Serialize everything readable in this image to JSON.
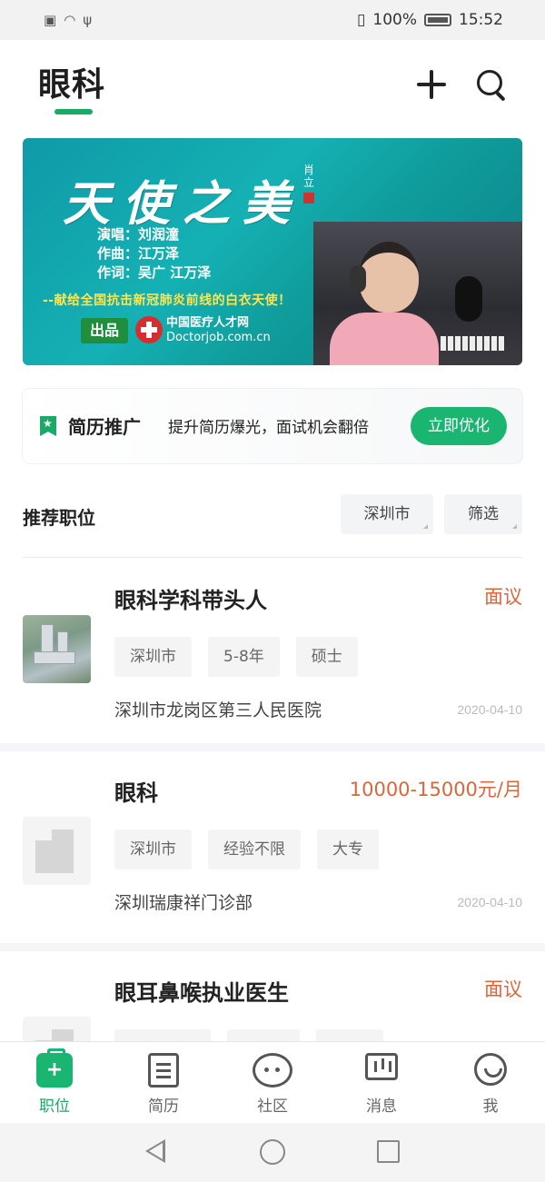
{
  "status_bar": {
    "left_icons": [
      "alert-icon",
      "wifi-icon",
      "usb-icon"
    ],
    "battery_percent": "100%",
    "time": "15:52"
  },
  "header": {
    "title": "眼科",
    "accent_color": "#1aaa68"
  },
  "banner": {
    "title": "天使之美",
    "seal_text": "肖立",
    "credits": [
      "演唱：刘润潼",
      "作曲：江万泽",
      "作词：吴广  江万泽"
    ],
    "slogan": "--献给全国抗击新冠肺炎前线的白衣天使！",
    "produced_label": "出品",
    "org_name": "中国医疗人才网",
    "org_site": "Doctorjob.com.cn"
  },
  "promo": {
    "title": "简历推广",
    "text": "提升简历爆光，面试机会翻倍",
    "button": "立即优化"
  },
  "section": {
    "title": "推荐职位",
    "city_filter": "深圳市",
    "more_filter": "筛选"
  },
  "jobs": [
    {
      "name": "眼科学科带头人",
      "salary": "面议",
      "tags": [
        "深圳市",
        "5-8年",
        "硕士"
      ],
      "hospital": "深圳市龙岗区第三人民医院",
      "date": "2020-04-10"
    },
    {
      "name": "眼科",
      "salary": "10000-15000元/月",
      "tags": [
        "深圳市",
        "经验不限",
        "大专"
      ],
      "hospital": "深圳瑞康祥门诊部",
      "date": "2020-04-10"
    },
    {
      "name": "眼耳鼻喉执业医生",
      "salary": "面议"
    }
  ],
  "tabbar": {
    "items": [
      {
        "label": "职位",
        "icon": "briefcase-icon",
        "active": true
      },
      {
        "label": "简历",
        "icon": "resume-icon",
        "active": false
      },
      {
        "label": "社区",
        "icon": "community-icon",
        "active": false
      },
      {
        "label": "消息",
        "icon": "message-icon",
        "active": false
      },
      {
        "label": "我",
        "icon": "profile-icon",
        "active": false
      }
    ]
  }
}
